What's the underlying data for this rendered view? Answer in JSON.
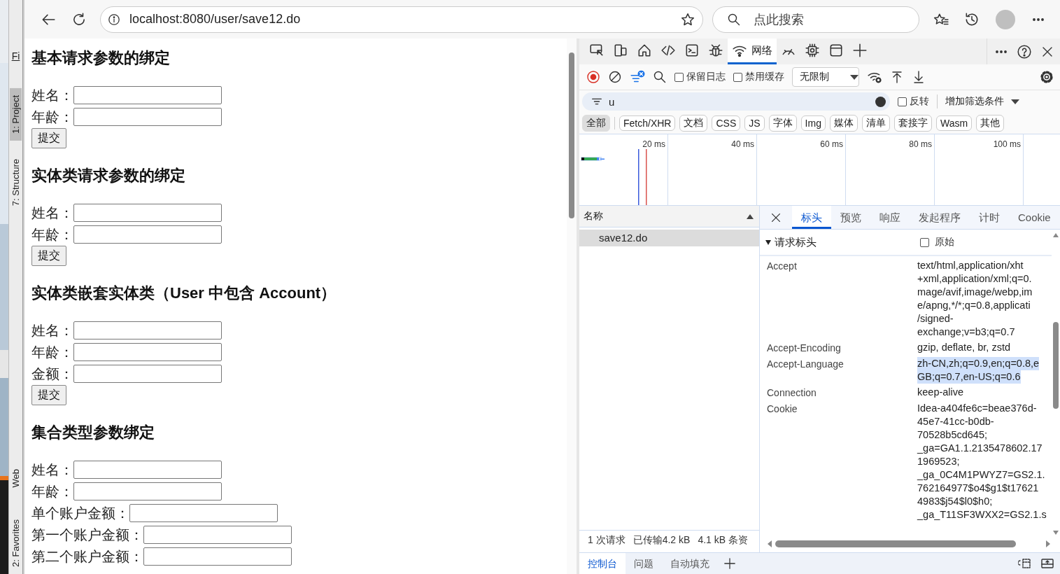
{
  "ide": {
    "menu": "Fi",
    "tool_tabs": [
      {
        "label": "1: Project",
        "selected": true
      },
      {
        "label": "7: Structure",
        "selected": false
      },
      {
        "label": "Web",
        "selected": false
      },
      {
        "label": "2: Favorites",
        "selected": false
      }
    ]
  },
  "browser": {
    "url": "localhost:8080/user/save12.do",
    "search_placeholder": "点此搜索"
  },
  "page": {
    "sections": [
      {
        "title": "基本请求参数的绑定",
        "fields": [
          {
            "label": "姓名："
          },
          {
            "label": "年龄："
          }
        ],
        "button": "提交"
      },
      {
        "title": "实体类请求参数的绑定",
        "fields": [
          {
            "label": "姓名："
          },
          {
            "label": "年龄："
          }
        ],
        "button": "提交"
      },
      {
        "title": "实体类嵌套实体类（User 中包含 Account）",
        "fields": [
          {
            "label": "姓名："
          },
          {
            "label": "年龄："
          },
          {
            "label": "金额："
          }
        ],
        "button": "提交"
      },
      {
        "title": "集合类型参数绑定",
        "fields": [
          {
            "label": "姓名："
          },
          {
            "label": "年龄："
          },
          {
            "label": "单个账户金额："
          },
          {
            "label": "第一个账户金额："
          },
          {
            "label": "第二个账户金额："
          }
        ]
      }
    ]
  },
  "devtools": {
    "tools": [
      {
        "kind": "inspect",
        "selected": false
      },
      {
        "kind": "device",
        "selected": false
      },
      {
        "kind": "home",
        "selected": false
      },
      {
        "kind": "sources",
        "selected": false
      },
      {
        "kind": "console",
        "selected": false
      },
      {
        "kind": "bug",
        "selected": false
      },
      {
        "kind": "network",
        "label": "网络",
        "selected": true
      },
      {
        "kind": "performance",
        "selected": false
      },
      {
        "kind": "memory",
        "selected": false
      },
      {
        "kind": "application",
        "selected": false
      },
      {
        "kind": "add",
        "selected": false
      }
    ],
    "toolbar": {
      "checkboxes": [
        {
          "label": "保留日志",
          "checked": false
        },
        {
          "label": "禁用缓存",
          "checked": false
        }
      ],
      "throttle": "无限制"
    },
    "filter": {
      "value": "u",
      "invert": {
        "label": "反转",
        "checked": false
      },
      "more": "增加筛选条件"
    },
    "types": [
      {
        "label": "全部",
        "selected": true
      },
      {
        "label": "Fetch/XHR",
        "selected": false
      },
      {
        "label": "文档",
        "selected": false
      },
      {
        "label": "CSS",
        "selected": false
      },
      {
        "label": "JS",
        "selected": false
      },
      {
        "label": "字体",
        "selected": false
      },
      {
        "label": "Img",
        "selected": false
      },
      {
        "label": "媒体",
        "selected": false
      },
      {
        "label": "清单",
        "selected": false
      },
      {
        "label": "套接字",
        "selected": false
      },
      {
        "label": "Wasm",
        "selected": false
      },
      {
        "label": "其他",
        "selected": false
      }
    ],
    "timeline": {
      "ticks": [
        "20 ms",
        "40 ms",
        "60 ms",
        "80 ms",
        "100 ms"
      ]
    },
    "requests": {
      "column": "名称",
      "rows": [
        {
          "name": "save12.do",
          "selected": true
        }
      ],
      "status": [
        "1 次请求",
        "已传输4.2 kB",
        "4.1 kB 条资"
      ]
    },
    "detail": {
      "tabs": [
        {
          "label": "标头",
          "selected": true
        },
        {
          "label": "预览",
          "selected": false
        },
        {
          "label": "响应",
          "selected": false
        },
        {
          "label": "发起程序",
          "selected": false
        },
        {
          "label": "计时",
          "selected": false
        },
        {
          "label": "Cookie",
          "selected": false
        }
      ],
      "section": {
        "title": "请求标头",
        "expanded": true,
        "raw": {
          "label": "原始",
          "checked": false
        }
      },
      "headers": [
        {
          "name": "Accept",
          "highlighted": false,
          "value_lines": [
            "text/html,application/xht",
            "+xml,application/xml;q=0.",
            "mage/avif,image/webp,im",
            "e/apng,*/*;q=0.8,applicati",
            "/signed-",
            "exchange;v=b3;q=0.7"
          ]
        },
        {
          "name": "Accept-Encoding",
          "highlighted": false,
          "value_lines": [
            "gzip, deflate, br, zstd"
          ]
        },
        {
          "name": "Accept-Language",
          "highlighted": true,
          "value_lines": [
            "zh-CN,zh;q=0.9,en;q=0.8,e",
            "GB;q=0.7,en-US;q=0.6"
          ]
        },
        {
          "name": "Connection",
          "highlighted": false,
          "value_lines": [
            "keep-alive"
          ]
        },
        {
          "name": "Cookie",
          "highlighted": false,
          "value_lines": [
            "Idea-a404fe6c=beae376d-",
            "45e7-41cc-b0db-",
            "70528b5cd645;",
            "_ga=GA1.1.2135478602.17",
            "1969523;",
            "_ga_0C4M1PWYZ7=GS2.1.",
            "762164977$o4$g1$t17621",
            "4983$j54$l0$h0;",
            "_ga_T11SF3WXX2=GS2.1.s"
          ]
        }
      ]
    },
    "drawer": {
      "tabs": [
        {
          "label": "控制台",
          "selected": true
        },
        {
          "label": "问题",
          "selected": false
        },
        {
          "label": "自动填充",
          "selected": false
        }
      ]
    }
  }
}
